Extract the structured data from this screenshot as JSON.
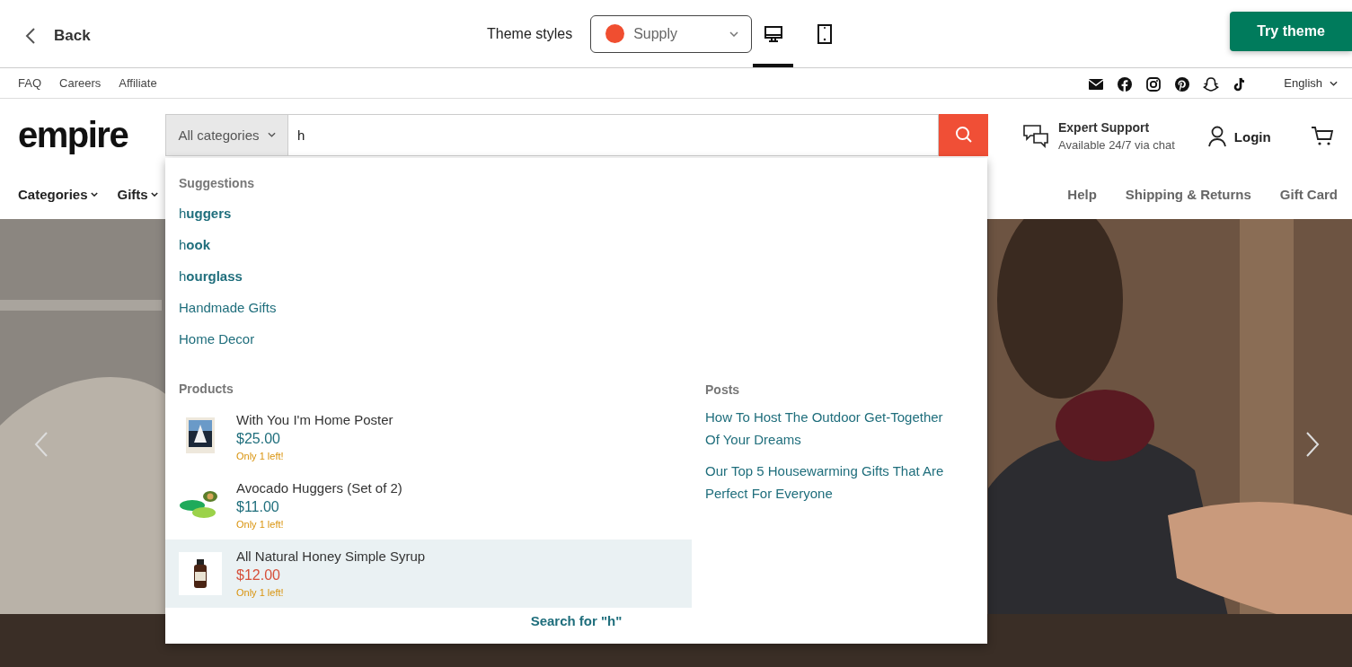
{
  "topbar": {
    "back": "Back",
    "theme_label": "Theme styles",
    "theme_select": "Supply",
    "views": [
      {
        "kind": "desktop",
        "selected": true
      },
      {
        "kind": "mobile",
        "selected": false
      }
    ],
    "try_button": "Try theme"
  },
  "utility": {
    "links": [
      "FAQ",
      "Careers",
      "Affiliate"
    ],
    "language": "English"
  },
  "header": {
    "logo": "empire",
    "search": {
      "category": "All categories",
      "value": "h"
    },
    "support": {
      "title": "Expert Support",
      "subtitle": "Available 24/7 via chat"
    },
    "login": "Login"
  },
  "nav": {
    "left": [
      "Categories",
      "Gifts"
    ],
    "right": [
      "Help",
      "Shipping & Returns",
      "Gift Card"
    ]
  },
  "dropdown": {
    "suggestions_title": "Suggestions",
    "suggestions": [
      "h**uggers**",
      "h**ook**",
      "h**ourglass**",
      "Handmade Gifts",
      "Home Decor"
    ],
    "products_title": "Products",
    "products": [
      {
        "name": "With You I'm Home Poster",
        "price": "$25.00",
        "stock": "Only 1 left!",
        "selected": false
      },
      {
        "name": "Avocado Huggers (Set of 2)",
        "price": "$11.00",
        "stock": "Only 1 left!",
        "selected": false
      },
      {
        "name": "All Natural Honey Simple Syrup",
        "price": "$12.00",
        "stock": "Only 1 left!",
        "selected": true
      }
    ],
    "posts_title": "Posts",
    "posts": [
      "How To Host The Outdoor Get-Together Of Your Dreams",
      "Our Top 5 Housewarming Gifts That Are Perfect For Everyone"
    ],
    "search_all": "Search for \"h\""
  }
}
